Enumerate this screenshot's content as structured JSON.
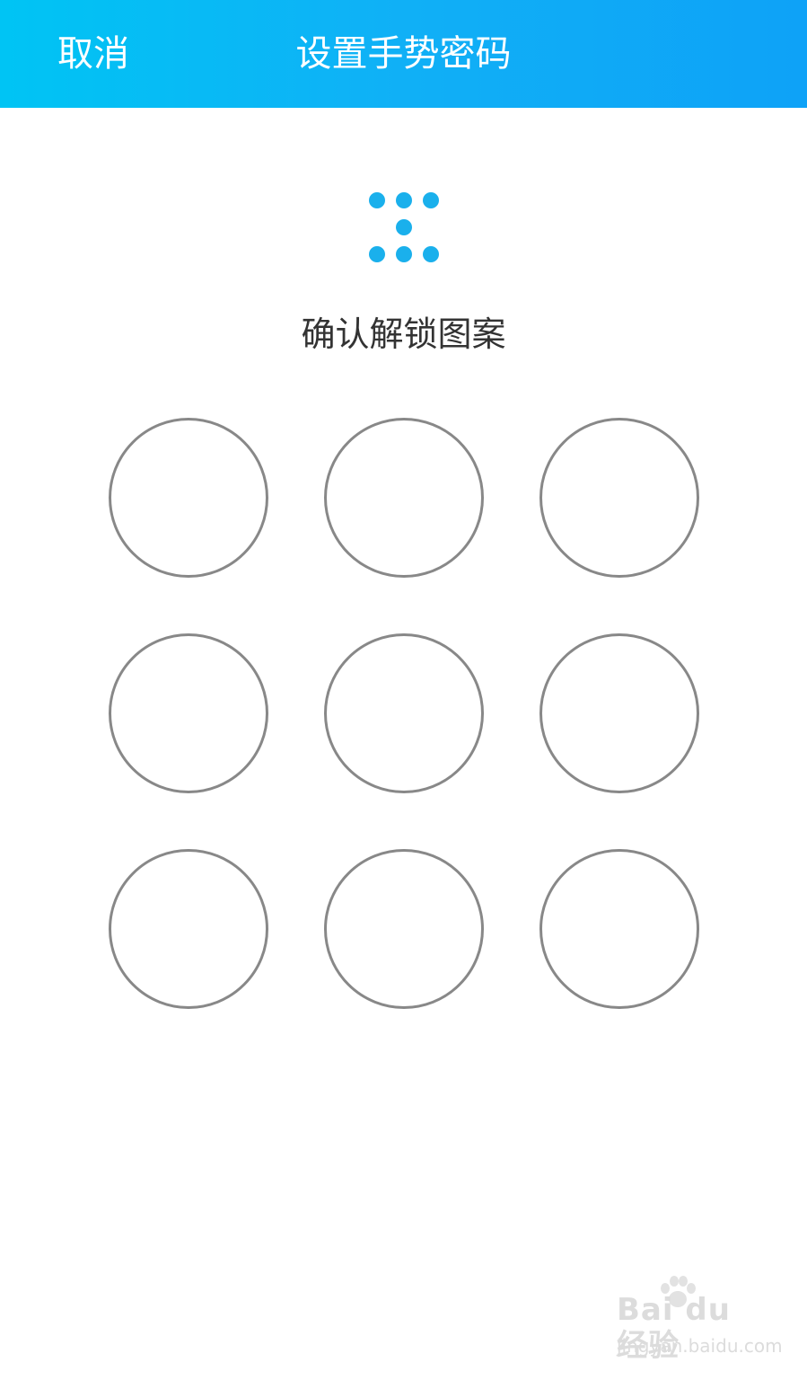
{
  "header": {
    "cancel_label": "取消",
    "title": "设置手势密码",
    "background_colors": [
      "#00c4f4",
      "#0ea2f7"
    ]
  },
  "hint_pattern": {
    "selected_dots": [
      0,
      1,
      2,
      4,
      6,
      7,
      8
    ],
    "dot_color": "#1ab0ec"
  },
  "prompt": "确认解锁图案",
  "gesture_grid": {
    "rows": 3,
    "cols": 3,
    "ring_color": "#888888"
  },
  "watermark": {
    "main": "Bai du 经验",
    "sub": "jingyan.baidu.com",
    "paw_icon": "baidu-paw-icon"
  }
}
